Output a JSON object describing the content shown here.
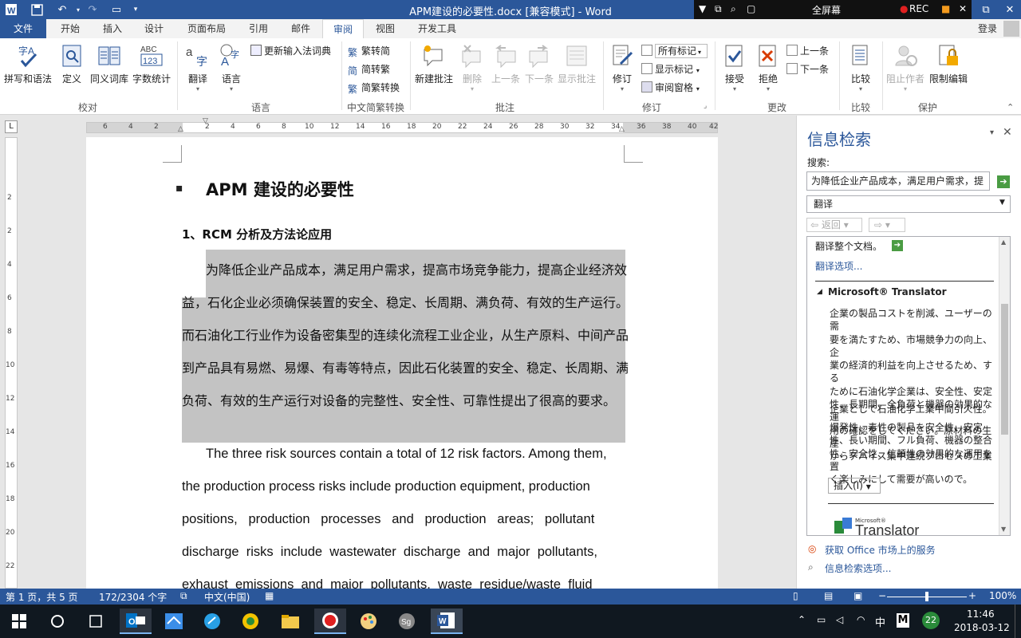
{
  "window": {
    "title": "APM建设的必要性.docx [兼容模式] - Word",
    "recorder": {
      "fullscreen": "全屏幕",
      "rec": "REC"
    }
  },
  "tabs": [
    {
      "label": "文件"
    },
    {
      "label": "开始"
    },
    {
      "label": "插入"
    },
    {
      "label": "设计"
    },
    {
      "label": "页面布局"
    },
    {
      "label": "引用"
    },
    {
      "label": "邮件"
    },
    {
      "label": "审阅"
    },
    {
      "label": "视图"
    },
    {
      "label": "开发工具"
    }
  ],
  "signin": "登录",
  "ribbon": {
    "proofing": {
      "spell": "拼写和语法",
      "define": "定义",
      "thesaurus": "同义词库",
      "wordcount": "字数统计",
      "group": "校对"
    },
    "language": {
      "translate": "翻译",
      "language": "语言",
      "update_ime": "更新输入法词典",
      "group": "语言"
    },
    "chinese": {
      "to_trad": "繁转简",
      "to_simp": "简转繁",
      "convert": "简繁转换",
      "group": "中文简繁转换"
    },
    "comments": {
      "new": "新建批注",
      "delete": "删除",
      "prev": "上一条",
      "next": "下一条",
      "show": "显示批注",
      "group": "批注"
    },
    "tracking": {
      "track": "修订",
      "all_markup": "所有标记",
      "show_markup": "显示标记",
      "pane": "审阅窗格",
      "group": "修订"
    },
    "changes": {
      "accept": "接受",
      "reject": "拒绝",
      "prev": "上一条",
      "next": "下一条",
      "group": "更改"
    },
    "compare": {
      "compare": "比较",
      "group": "比较"
    },
    "protect": {
      "block": "阻止作者",
      "restrict": "限制编辑",
      "group": "保护"
    },
    "ruler_letter": "L"
  },
  "ruler": {
    "h": [
      "6",
      "4",
      "2",
      "2",
      "4",
      "6",
      "8",
      "10",
      "12",
      "14",
      "16",
      "18",
      "20",
      "22",
      "24",
      "26",
      "28",
      "30",
      "32",
      "34",
      "36",
      "38",
      "40",
      "42"
    ],
    "v": [
      "2",
      "2",
      "4",
      "6",
      "8",
      "10",
      "12",
      "14",
      "16",
      "18",
      "20",
      "22"
    ]
  },
  "doc": {
    "title": "APM 建设的必要性",
    "heading": "1、RCM 分析及方法论应用",
    "para1": [
      "为降低企业产品成本，满足用户需求，提高市场竞争能力，提高企业经济效",
      "益，石化企业必须确保装置的安全、稳定、长周期、满负荷、有效的生产运行。",
      "而石油化工行业作为设备密集型的连续化流程工业企业，从生产原料、中间产品",
      "到产品具有易燃、易爆、有毒等特点，因此石化装置的安全、稳定、长周期、满",
      "负荷、有效的生产运行对设备的完整性、安全性、可靠性提出了很高的要求。"
    ],
    "para2": [
      "The three risk sources contain a total of 12 risk factors. Among them,",
      "the production process risks include production equipment, production",
      "positions,   production   processes   and   production   areas;   pollutant",
      "discharge  risks  include  wastewater  discharge  and  major  pollutants,",
      "exhaust  emissions  and  major  pollutants,  waste  residue/waste  fluid"
    ]
  },
  "pane": {
    "title": "信息检索",
    "search_label": "搜索:",
    "search_value": "为降低企业产品成本，满足用户需求，提",
    "service": "翻译",
    "back": "返回",
    "translate_doc": "翻译整个文档。",
    "translate_opts": "翻译选项...",
    "provider": "Microsoft® Translator",
    "result": [
      "企業の製品コストを削減、ユーザーの需",
      "要を満たすため、市場競争力の向上、企",
      "業の経済的利益を向上させるため、する",
      "ために石油化学企業は、安全性、安定",
      "性、長期間、全負荷と機器の効果的な運",
      "用の確認をしてください。原材料の生産",
      "からデバイス集中連続プロセスの工業"
    ],
    "result2": "企業として石油化学工業中間引火性。",
    "result3": [
      "爆発性、毒性の製品を安全性、安定",
      "性、長い期間、フル負荷、機器の整合",
      "性、安全性、信頼性の効果的な運用を置",
      "く楽しみにして需要が高いので。"
    ],
    "insert": "插入(I)",
    "logo_small": "Microsoft®",
    "logo": "Translator",
    "get_services": "获取 Office 市场上的服务",
    "research_opts": "信息检索选项..."
  },
  "status": {
    "page": "第 1 页，共 5 页",
    "words": "172/2304 个字",
    "lang": "中文(中国)",
    "zoom": "100%"
  },
  "clock": {
    "time": "11:46",
    "date": "2018-03-12",
    "badge": "22",
    "ime": "中",
    "ime2": "M"
  }
}
